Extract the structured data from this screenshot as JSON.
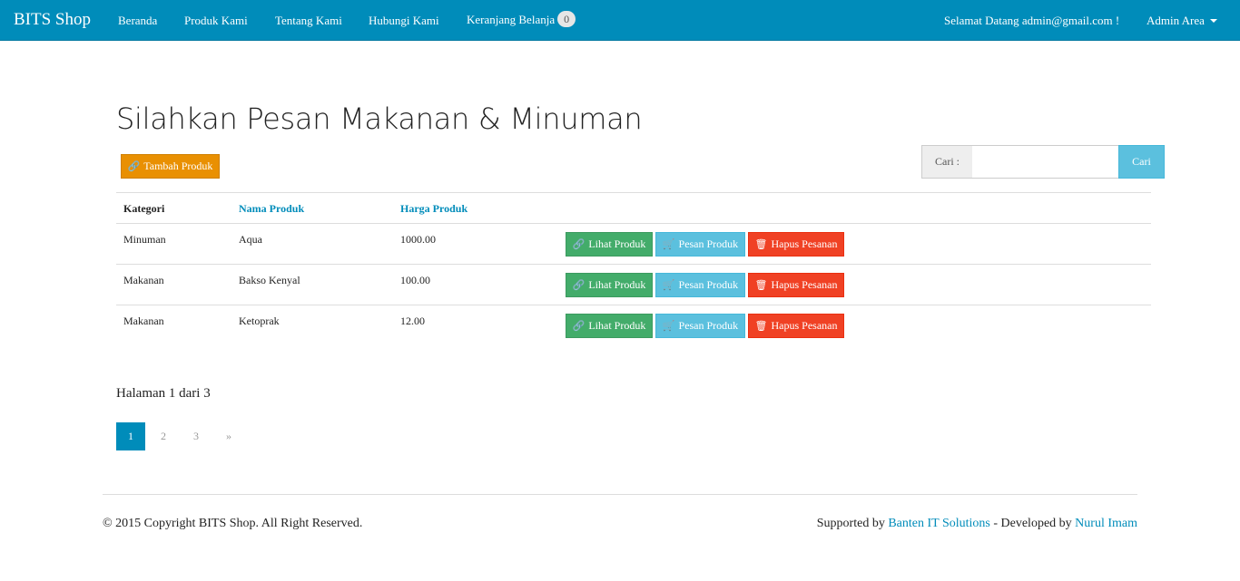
{
  "navbar": {
    "brand": "BITS Shop",
    "links": [
      "Beranda",
      "Produk Kami",
      "Tentang Kami",
      "Hubungi Kami"
    ],
    "cart_label": "Keranjang Belanja",
    "cart_count": "0",
    "welcome": "Selamat Datang admin@gmail.com !",
    "admin_label": "Admin Area"
  },
  "page": {
    "title": "Silahkan Pesan Makanan & Minuman",
    "add_button": "Tambah Produk"
  },
  "search": {
    "label": "Cari :",
    "value": "",
    "button": "Cari"
  },
  "table": {
    "headers": [
      "Kategori",
      "Nama Produk",
      "Harga Produk"
    ],
    "rows": [
      {
        "kategori": "Minuman",
        "nama": "Aqua",
        "harga": "1000.00"
      },
      {
        "kategori": "Makanan",
        "nama": "Bakso Kenyal",
        "harga": "100.00"
      },
      {
        "kategori": "Makanan",
        "nama": "Ketoprak",
        "harga": "12.00"
      }
    ],
    "actions": {
      "view": "Lihat Produk",
      "order": "Pesan Produk",
      "delete": "Hapus Pesanan"
    }
  },
  "pagination": {
    "info": "Halaman 1 dari 3",
    "pages": [
      "1",
      "2",
      "3"
    ],
    "next": "»",
    "current": "1"
  },
  "footer": {
    "copyright": "© 2015 Copyright BITS Shop. All Right Reserved.",
    "supported_prefix": "Supported by",
    "supporter": "Banten IT Solutions",
    "developed_prefix": "- Developed by",
    "developer": "Nurul Imam"
  },
  "colors": {
    "primary": "#008cba",
    "warning": "#e99002",
    "success": "#43ac6a",
    "info": "#5bc0de",
    "danger": "#f04124"
  },
  "icons": {
    "link": "link-icon",
    "cart": "cart-icon",
    "trash": "trash-icon",
    "caret": "caret-down-icon"
  }
}
